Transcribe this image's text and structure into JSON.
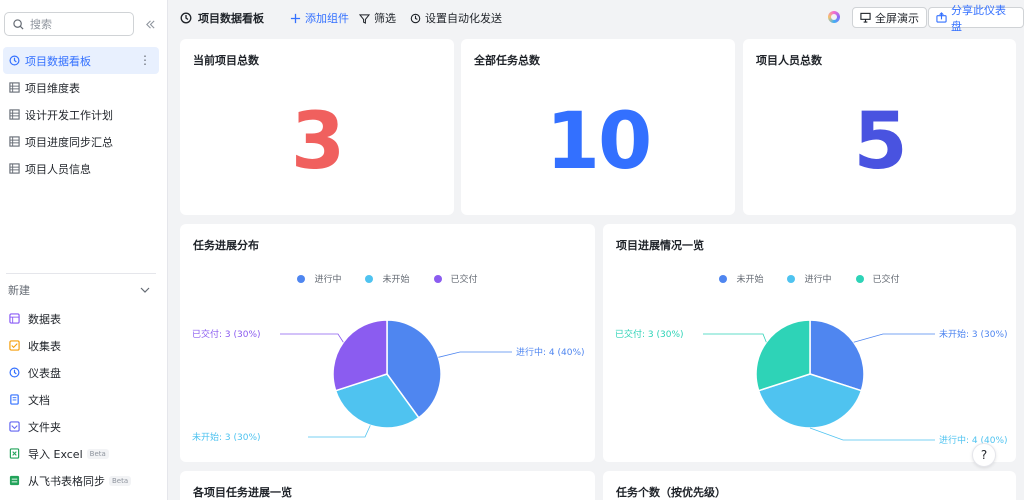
{
  "sidebar": {
    "search_placeholder": "搜索",
    "items": [
      {
        "label": "项目数据看板",
        "icon": "dashboard-icon",
        "active": true
      },
      {
        "label": "项目维度表",
        "icon": "table-icon"
      },
      {
        "label": "设计开发工作计划",
        "icon": "table-icon"
      },
      {
        "label": "项目进度同步汇总",
        "icon": "table-icon"
      },
      {
        "label": "项目人员信息",
        "icon": "table-icon"
      }
    ],
    "new_label": "新建",
    "new_items": [
      {
        "label": "数据表",
        "icon": "table-icon",
        "color": "#8b5cf6"
      },
      {
        "label": "收集表",
        "icon": "form-icon",
        "color": "#f59e0b"
      },
      {
        "label": "仪表盘",
        "icon": "dashboard-icon",
        "color": "#3370ff"
      },
      {
        "label": "文档",
        "icon": "doc-icon",
        "color": "#3370ff"
      },
      {
        "label": "文件夹",
        "icon": "folder-icon",
        "color": "#6366f1"
      },
      {
        "label": "导入 Excel",
        "icon": "excel-icon",
        "color": "#22a35a",
        "badge": "Beta"
      },
      {
        "label": "从飞书表格同步",
        "icon": "sheet-sync-icon",
        "color": "#22a35a",
        "badge": "Beta"
      }
    ]
  },
  "toolbar": {
    "title": "项目数据看板",
    "add_component": "添加组件",
    "filter": "筛选",
    "auto_send": "设置自动化发送",
    "fullscreen": "全屏演示",
    "share": "分享此仪表盘"
  },
  "stats": [
    {
      "title": "当前项目总数",
      "value": "3",
      "color": "#f0605e"
    },
    {
      "title": "全部任务总数",
      "value": "10",
      "color": "#3370ff"
    },
    {
      "title": "项目人员总数",
      "value": "5",
      "color": "#4953e0"
    }
  ],
  "charts": {
    "left_title": "任务进展分布",
    "right_title": "项目进展情况一览",
    "bottom_left_title": "各项目任务进展一览",
    "bottom_right_title": "任务个数（按优先级）"
  },
  "chart_data": [
    {
      "type": "pie",
      "title": "任务进展分布",
      "slices": [
        {
          "name": "进行中",
          "value": 4,
          "percent": 40,
          "color": "#4f86f0",
          "label": "进行中: 4 (40%)"
        },
        {
          "name": "未开始",
          "value": 3,
          "percent": 30,
          "color": "#4fc3f0",
          "label": "未开始: 3 (30%)"
        },
        {
          "name": "已交付",
          "value": 3,
          "percent": 30,
          "color": "#8b5cf0",
          "label": "已交付: 3 (30%)"
        }
      ],
      "legend": [
        "进行中",
        "未开始",
        "已交付"
      ]
    },
    {
      "type": "pie",
      "title": "项目进展情况一览",
      "slices": [
        {
          "name": "未开始",
          "value": 3,
          "percent": 30,
          "color": "#4f86f0",
          "label": "未开始: 3 (30%)"
        },
        {
          "name": "进行中",
          "value": 4,
          "percent": 40,
          "color": "#4fc3f0",
          "label": "进行中: 4 (40%)"
        },
        {
          "name": "已交付",
          "value": 3,
          "percent": 30,
          "color": "#2ed3b7",
          "label": "已交付: 3 (30%)"
        }
      ],
      "legend": [
        "未开始",
        "进行中",
        "已交付"
      ]
    }
  ]
}
